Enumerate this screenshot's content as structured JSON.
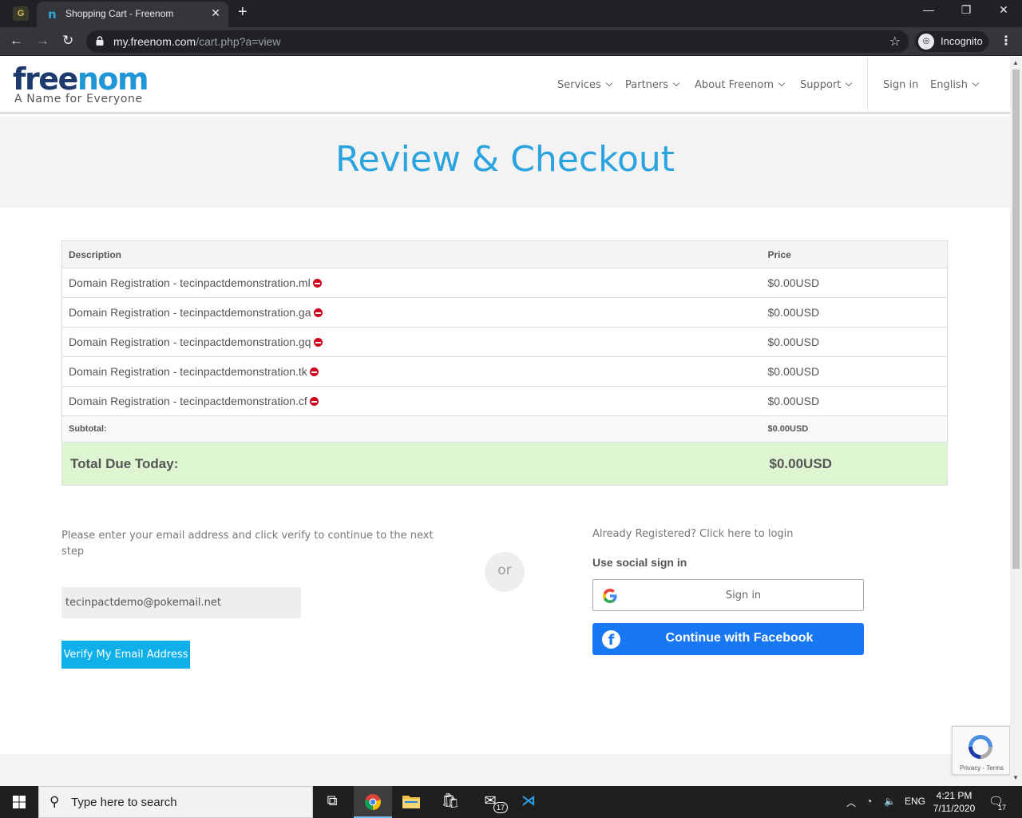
{
  "browser": {
    "tab_title": "Shopping Cart - Freenom",
    "url_host": "my.freenom.com",
    "url_path": "/cart.php?a=view",
    "incognito_label": "Incognito"
  },
  "header": {
    "logo_part1": "free",
    "logo_part2": "nom",
    "tagline": "A Name for Everyone",
    "nav": {
      "services": "Services",
      "partners": "Partners",
      "about": "About Freenom",
      "support": "Support",
      "signin": "Sign in",
      "language": "English"
    }
  },
  "hero": {
    "title": "Review & Checkout"
  },
  "cart": {
    "headers": {
      "description": "Description",
      "price": "Price"
    },
    "items": [
      {
        "description": "Domain Registration - tecinpactdemonstration.ml",
        "price": "$0.00USD"
      },
      {
        "description": "Domain Registration - tecinpactdemonstration.ga",
        "price": "$0.00USD"
      },
      {
        "description": "Domain Registration - tecinpactdemonstration.gq",
        "price": "$0.00USD"
      },
      {
        "description": "Domain Registration - tecinpactdemonstration.tk",
        "price": "$0.00USD"
      },
      {
        "description": "Domain Registration - tecinpactdemonstration.cf",
        "price": "$0.00USD"
      }
    ],
    "subtotal_label": "Subtotal:",
    "subtotal_value": "$0.00USD",
    "total_label": "Total Due Today:",
    "total_value": "$0.00USD"
  },
  "email": {
    "instructions": "Please enter your email address and click verify to continue to the next step",
    "value": "tecinpactdemo@pokemail.net",
    "verify_label": "Verify My Email Address"
  },
  "divider_or": "or",
  "login": {
    "already_registered": "Already Registered? Click here to login",
    "social_label": "Use social sign in",
    "google_label": "Sign in",
    "facebook_label": "Continue with Facebook"
  },
  "recaptcha": {
    "text": "Privacy - Terms"
  },
  "taskbar": {
    "search_placeholder": "Type here to search",
    "mail_badge": "17",
    "language": "ENG",
    "time": "4:21 PM",
    "date": "7/11/2020",
    "notification_count": "17"
  },
  "colors": {
    "accent": "#2ba3de",
    "verify_button": "#0fb0ea",
    "total_row": "#ddf5d0",
    "facebook": "#1877f2",
    "remove_icon": "#d0021b"
  }
}
